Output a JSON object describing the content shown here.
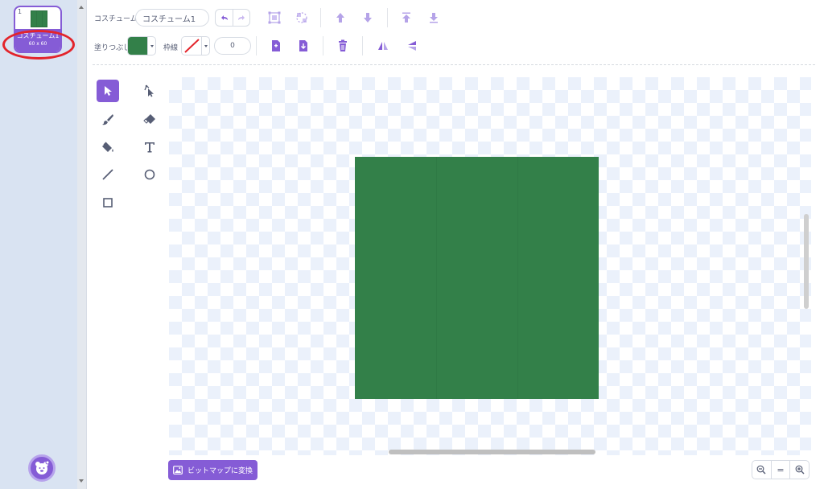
{
  "costume_list": {
    "items": [
      {
        "index": "1",
        "name": "コスチューム1",
        "size": "60 x 60"
      }
    ]
  },
  "toolbar": {
    "costume_label": "コスチューム",
    "costume_name": "コスチューム1",
    "fill_label": "塗りつぶし",
    "fill_color": "#338049",
    "outline_label": "枠線",
    "outline_width": "0",
    "icons": [
      "undo-icon",
      "redo-icon",
      "group-icon",
      "ungroup-icon",
      "forward-icon",
      "backward-icon",
      "front-icon",
      "back-icon",
      "copy-icon",
      "paste-icon",
      "delete-icon",
      "flip-horizontal-icon",
      "flip-vertical-icon"
    ]
  },
  "tools": [
    "select-tool",
    "reshape-tool",
    "brush-tool",
    "eraser-tool",
    "fill-tool",
    "text-tool",
    "line-tool",
    "circle-tool",
    "rectangle-tool"
  ],
  "canvas": {
    "shape_color": "#338049"
  },
  "footer": {
    "convert_label": "ビットマップに変換",
    "zoom_reset_label": "="
  },
  "colors": {
    "accent": "#855cd6",
    "highlight": "#e3242b"
  }
}
